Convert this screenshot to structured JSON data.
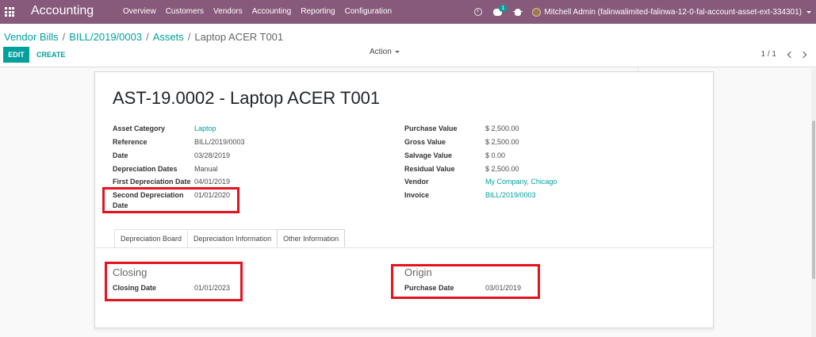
{
  "navbar": {
    "app_title": "Accounting",
    "menu": [
      "Overview",
      "Customers",
      "Vendors",
      "Accounting",
      "Reporting",
      "Configuration"
    ],
    "chat_badge": "1",
    "user": "Mitchell Admin (falinwalimited-falinwa-12-0-fal-account-asset-ext-334301)",
    "color": "#875a7b"
  },
  "breadcrumb": {
    "items": [
      "Vendor Bills",
      "BILL/2019/0003",
      "Assets"
    ],
    "current": "Laptop ACER T001"
  },
  "buttons": {
    "edit": "EDIT",
    "create": "CREATE"
  },
  "action": {
    "label": "Action"
  },
  "pager": {
    "value": "1 / 1"
  },
  "record": {
    "title": "AST-19.0002 - Laptop ACER T001",
    "left_fields": [
      {
        "label": "Asset Category",
        "value": "Laptop"
      },
      {
        "label": "Reference",
        "value": "BILL/2019/0003"
      },
      {
        "label": "Date",
        "value": "03/28/2019"
      },
      {
        "label": "Depreciation Dates",
        "value": "Manual"
      },
      {
        "label": "First Depreciation Date",
        "value": "04/01/2019"
      },
      {
        "label": "Second Depreciation",
        "label2": "Date",
        "value": "01/01/2020"
      }
    ],
    "right_fields": [
      {
        "label": "Purchase Value",
        "value": "$ 2,500.00"
      },
      {
        "label": "Gross Value",
        "value": "$ 2,500.00"
      },
      {
        "label": "Salvage Value",
        "value": "$ 0.00"
      },
      {
        "label": "Residual Value",
        "value": "$ 2,500.00"
      },
      {
        "label": "Vendor",
        "value": "My Company, Chicago"
      },
      {
        "label": "Invoice",
        "value": "BILL/2019/0003"
      }
    ]
  },
  "tabs": [
    "Depreciation Board",
    "Depreciation Information",
    "Other Information"
  ],
  "active_tab": "Other Information",
  "other_info": {
    "closing": {
      "title": "Closing",
      "label": "Closing Date",
      "value": "01/01/2023"
    },
    "origin": {
      "title": "Origin",
      "label": "Purchase Date",
      "value": "03/01/2019"
    }
  },
  "colors": {
    "accent": "#00a09d",
    "highlight": "#e5131e"
  }
}
